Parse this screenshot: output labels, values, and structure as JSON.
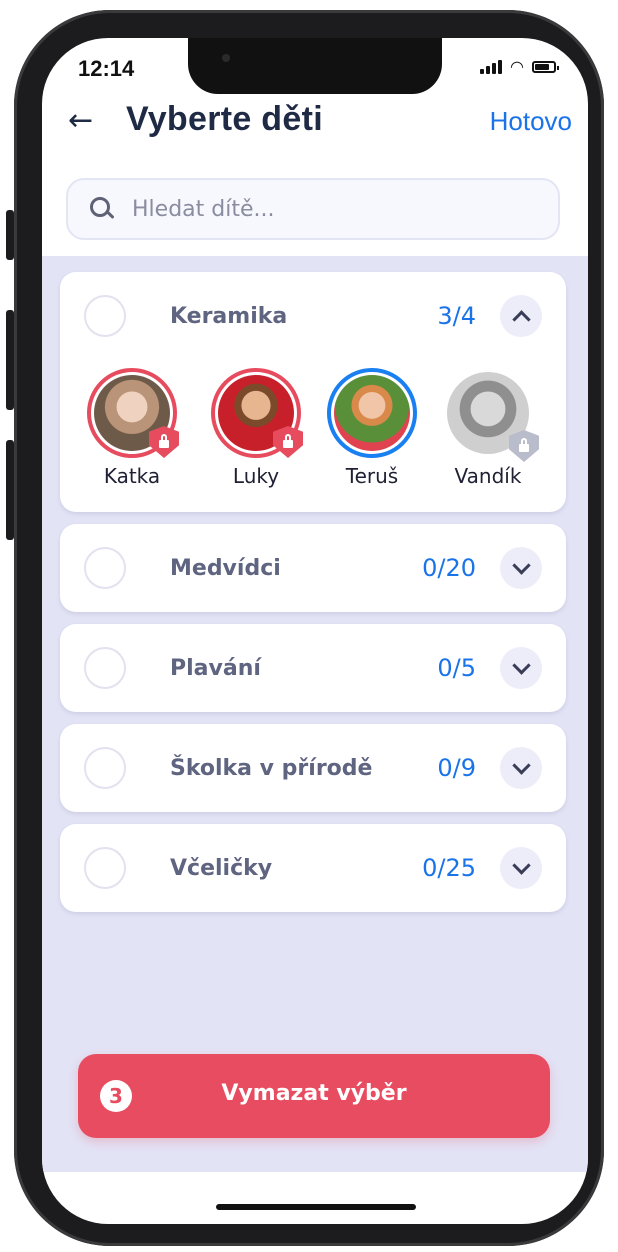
{
  "status_bar": {
    "time": "12:14"
  },
  "header": {
    "title": "Vyberte děti",
    "done_label": "Hotovo"
  },
  "search": {
    "placeholder": "Hledat dítě..."
  },
  "groups": [
    {
      "name": "Keramika",
      "count": "3/4",
      "expanded": true
    },
    {
      "name": "Medvídci",
      "count": "0/20",
      "expanded": false
    },
    {
      "name": "Plavání",
      "count": "0/5",
      "expanded": false
    },
    {
      "name": "Školka v přírodě",
      "count": "0/9",
      "expanded": false
    },
    {
      "name": "Včeličky",
      "count": "0/25",
      "expanded": false
    }
  ],
  "children": [
    {
      "name": "Katka",
      "ring": "red",
      "badge": "red-lock"
    },
    {
      "name": "Luky",
      "ring": "red",
      "badge": "red-lock"
    },
    {
      "name": "Teruš",
      "ring": "blue",
      "badge": "none"
    },
    {
      "name": "Vandík",
      "ring": "none",
      "badge": "grey-lock"
    }
  ],
  "clear_button": {
    "count": "3",
    "label": "Vymazat výběr"
  },
  "colors": {
    "accent_blue": "#1a73e8",
    "selected_red": "#e74c5e",
    "selected_blue": "#1a7ff0",
    "background_lavender": "#e3e3f6"
  }
}
